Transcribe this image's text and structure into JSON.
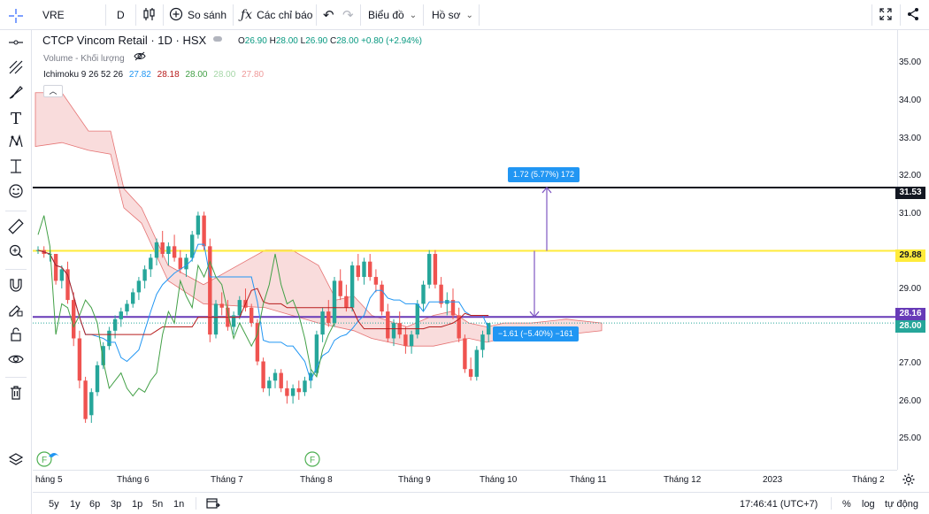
{
  "toolbar": {
    "symbol": "VRE",
    "interval": "D",
    "compare_label": "So sánh",
    "indicators_label": "Các chỉ báo",
    "chart_label": "Biểu đồ",
    "profile_label": "Hồ sơ"
  },
  "legend": {
    "title": "CTCP Vincom Retail · 1D · HSX",
    "open": "26.90",
    "high": "28.00",
    "low": "26.90",
    "close": "28.00",
    "change": "+0.80 (+2.94%)",
    "volume_label": "Volume - Khối lượng",
    "ichimoku_label": "Ichimoku 9 26 52 26",
    "ichimoku_values": [
      "27.82",
      "28.18",
      "28.00",
      "28.00",
      "27.80"
    ],
    "ichimoku_colors": [
      "#2196f3",
      "#b71c1c",
      "#43a047",
      "#a5d6a7",
      "#ef9a9a"
    ]
  },
  "price_axis": {
    "ticks": [
      "35.00",
      "34.00",
      "33.00",
      "32.00",
      "31.00",
      "29.00",
      "27.00",
      "26.00",
      "25.00"
    ],
    "labels": [
      {
        "text": "31.53",
        "color": "#131722"
      },
      {
        "text": "29.88",
        "color": "#ffeb3b"
      },
      {
        "text": "28.16",
        "color": "#673ab7"
      },
      {
        "text": "28.00",
        "color": "#26a69a"
      }
    ]
  },
  "time_axis": {
    "ticks": [
      "háng 5",
      "Tháng 6",
      "Tháng 7",
      "Tháng 8",
      "Tháng 9",
      "Tháng 10",
      "Tháng 11",
      "Tháng 12",
      "2023",
      "Tháng 2"
    ]
  },
  "measurements": {
    "up": "1.72 (5.77%) 172",
    "down": "−1.61 (−5.40%) −161"
  },
  "event_marker": "F",
  "bottom": {
    "ranges": [
      "5y",
      "1y",
      "6p",
      "3p",
      "1p",
      "5n",
      "1n"
    ],
    "time": "17:46:41 (UTC+7)",
    "percent": "%",
    "log": "log",
    "auto": "tự động"
  },
  "chart_data": {
    "type": "candlestick",
    "title": "CTCP Vincom Retail · 1D · HSX",
    "ylim": [
      24.8,
      35.4
    ],
    "x_labels": [
      "Tháng 5",
      "Tháng 6",
      "Tháng 7",
      "Tháng 8",
      "Tháng 9",
      "Tháng 10",
      "Tháng 11",
      "Tháng 12",
      "2023",
      "Tháng 2"
    ],
    "horizontal_lines": [
      {
        "price": 31.53,
        "color": "#131722"
      },
      {
        "price": 29.88,
        "color": "#ffeb3b"
      },
      {
        "price": 28.16,
        "color": "#673ab7"
      }
    ],
    "candles": [
      [
        29.9,
        30.0,
        29.8,
        29.9
      ],
      [
        29.9,
        30.0,
        29.7,
        29.8
      ],
      [
        29.8,
        29.9,
        29.6,
        29.8
      ],
      [
        29.8,
        29.8,
        29.0,
        29.1
      ],
      [
        29.1,
        29.5,
        28.9,
        29.4
      ],
      [
        29.4,
        29.6,
        28.5,
        28.6
      ],
      [
        28.6,
        28.8,
        27.4,
        27.6
      ],
      [
        27.6,
        27.8,
        26.3,
        26.5
      ],
      [
        26.5,
        26.6,
        25.4,
        25.5
      ],
      [
        25.6,
        26.3,
        25.4,
        26.2
      ],
      [
        26.2,
        27.0,
        26.1,
        26.9
      ],
      [
        26.9,
        27.5,
        26.8,
        27.4
      ],
      [
        27.4,
        27.9,
        27.3,
        27.8
      ],
      [
        27.8,
        28.2,
        27.6,
        28.1
      ],
      [
        28.1,
        28.4,
        27.9,
        28.3
      ],
      [
        28.3,
        28.6,
        28.2,
        28.5
      ],
      [
        28.5,
        28.9,
        28.4,
        28.8
      ],
      [
        28.8,
        29.2,
        28.6,
        29.1
      ],
      [
        29.1,
        29.5,
        28.9,
        29.4
      ],
      [
        29.4,
        29.8,
        29.2,
        29.7
      ],
      [
        29.7,
        30.2,
        29.5,
        30.1
      ],
      [
        30.1,
        30.4,
        29.7,
        29.8
      ],
      [
        29.8,
        30.1,
        29.5,
        30.0
      ],
      [
        30.0,
        30.3,
        29.6,
        29.7
      ],
      [
        29.7,
        29.9,
        29.3,
        29.4
      ],
      [
        29.4,
        29.8,
        29.2,
        29.7
      ],
      [
        29.7,
        30.4,
        29.6,
        30.3
      ],
      [
        30.3,
        30.9,
        30.2,
        30.8
      ],
      [
        30.8,
        30.9,
        29.9,
        30.0
      ],
      [
        30.0,
        30.2,
        27.5,
        27.7
      ],
      [
        27.7,
        28.6,
        27.6,
        28.5
      ],
      [
        28.5,
        28.8,
        28.2,
        28.4
      ],
      [
        28.4,
        28.6,
        27.8,
        27.9
      ],
      [
        27.9,
        28.3,
        27.7,
        28.2
      ],
      [
        28.2,
        28.7,
        28.1,
        28.6
      ],
      [
        28.6,
        28.9,
        28.3,
        28.4
      ],
      [
        28.4,
        28.5,
        27.9,
        28.0
      ],
      [
        28.0,
        28.1,
        26.9,
        27.0
      ],
      [
        27.0,
        27.1,
        26.2,
        26.3
      ],
      [
        26.3,
        26.6,
        26.1,
        26.5
      ],
      [
        26.5,
        26.8,
        26.3,
        26.7
      ],
      [
        26.7,
        26.8,
        26.2,
        26.3
      ],
      [
        26.3,
        26.5,
        25.9,
        26.1
      ],
      [
        26.1,
        26.4,
        25.9,
        26.3
      ],
      [
        26.3,
        26.5,
        26.0,
        26.2
      ],
      [
        26.2,
        26.6,
        26.1,
        26.5
      ],
      [
        26.5,
        26.8,
        26.3,
        26.7
      ],
      [
        26.7,
        27.8,
        26.6,
        27.7
      ],
      [
        27.7,
        28.4,
        27.5,
        28.3
      ],
      [
        28.3,
        28.6,
        27.9,
        28.0
      ],
      [
        28.0,
        29.2,
        27.9,
        29.1
      ],
      [
        29.1,
        29.4,
        28.6,
        28.7
      ],
      [
        28.7,
        29.0,
        28.3,
        28.4
      ],
      [
        28.4,
        29.6,
        28.3,
        29.5
      ],
      [
        29.5,
        29.8,
        29.1,
        29.2
      ],
      [
        29.2,
        29.7,
        29.0,
        29.6
      ],
      [
        29.6,
        29.8,
        29.1,
        29.2
      ],
      [
        29.2,
        29.4,
        28.8,
        29.0
      ],
      [
        29.0,
        29.1,
        28.2,
        28.3
      ],
      [
        28.3,
        28.5,
        27.5,
        27.6
      ],
      [
        27.6,
        28.1,
        27.4,
        28.0
      ],
      [
        28.0,
        28.3,
        27.6,
        27.7
      ],
      [
        27.7,
        27.9,
        27.2,
        27.4
      ],
      [
        27.4,
        27.8,
        27.2,
        27.7
      ],
      [
        27.7,
        28.6,
        27.6,
        28.5
      ],
      [
        28.5,
        29.1,
        28.3,
        29.0
      ],
      [
        29.0,
        29.9,
        28.9,
        29.8
      ],
      [
        29.8,
        29.9,
        28.9,
        29.0
      ],
      [
        29.0,
        29.2,
        28.4,
        28.5
      ],
      [
        28.5,
        28.8,
        28.2,
        28.6
      ],
      [
        28.6,
        28.9,
        28.1,
        28.2
      ],
      [
        28.2,
        28.4,
        27.5,
        27.6
      ],
      [
        27.6,
        27.7,
        26.7,
        26.8
      ],
      [
        26.8,
        27.1,
        26.5,
        26.6
      ],
      [
        26.6,
        27.4,
        26.5,
        27.3
      ],
      [
        27.3,
        27.8,
        27.1,
        27.7
      ],
      [
        27.7,
        28.0,
        27.5,
        28.0
      ]
    ]
  }
}
